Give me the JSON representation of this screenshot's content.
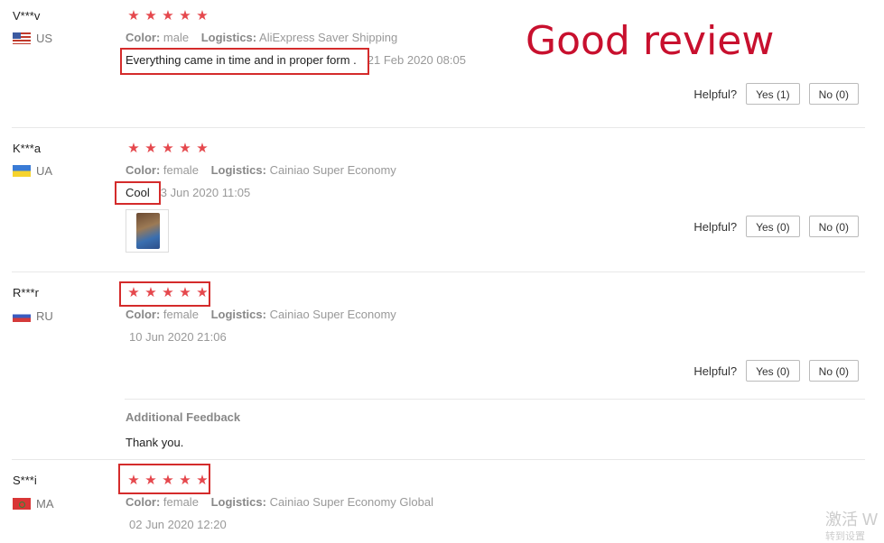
{
  "annotation": "Good review",
  "helpful_label": "Helpful?",
  "star_glyph": "★",
  "rating_stars": 5,
  "labels": {
    "color": "Color:",
    "logistics": "Logistics:"
  },
  "highlight_color": "#d42b2b",
  "reviews": [
    {
      "user": "V***v",
      "country": "US",
      "color": "male",
      "logistics": "AliExpress Saver Shipping",
      "content": "Everything came in time and in proper form .",
      "date": "21 Feb 2020 08:05",
      "yes": "Yes (1)",
      "no": "No (0)"
    },
    {
      "user": "K***a",
      "country": "UA",
      "color": "female",
      "logistics": "Cainiao Super Economy",
      "content": "Cool",
      "date": "3 Jun 2020 11:05",
      "yes": "Yes (0)",
      "no": "No (0)"
    },
    {
      "user": "R***r",
      "country": "RU",
      "color": "female",
      "logistics": "Cainiao Super Economy",
      "date": "10 Jun 2020 21:06",
      "yes": "Yes (0)",
      "no": "No (0)",
      "additional_title": "Additional Feedback",
      "additional_text": "Thank you."
    },
    {
      "user": "S***i",
      "country": "MA",
      "color": "female",
      "logistics": "Cainiao Super Economy Global",
      "date": "02 Jun 2020 12:20"
    }
  ],
  "watermark": {
    "line1": "激活 W",
    "line2": "转到设置"
  }
}
